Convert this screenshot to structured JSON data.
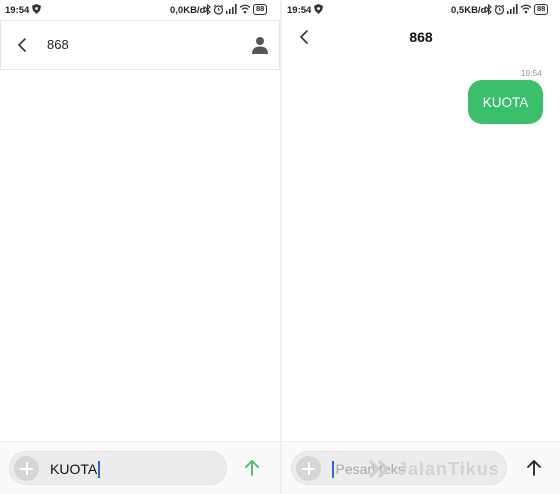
{
  "left_screen": {
    "status": {
      "time": "19:54",
      "network_speed": "0,0KB/d",
      "battery": "88"
    },
    "header": {
      "recipient": "868"
    },
    "composer": {
      "value": "KUOTA"
    }
  },
  "right_screen": {
    "status": {
      "time": "19:54",
      "network_speed": "0,5KB/d",
      "battery": "88"
    },
    "header": {
      "title": "868"
    },
    "conversation": {
      "messages": [
        {
          "time": "19:54",
          "text": "KUOTA",
          "direction": "sent"
        }
      ]
    },
    "composer": {
      "placeholder": "Pesan teks",
      "value": ""
    }
  },
  "watermark": {
    "text": "JalanTikus"
  },
  "colors": {
    "bubble": "#3bbf6a",
    "send_active": "#3bbf6a",
    "send_inactive": "#222222",
    "caret": "#2c6bd6"
  },
  "icons": [
    "shield-icon",
    "bluetooth-icon",
    "alarm-icon",
    "signal-icon",
    "wifi-icon",
    "battery-icon",
    "back-arrow-icon",
    "contact-icon",
    "plus-icon",
    "send-arrow-icon"
  ]
}
